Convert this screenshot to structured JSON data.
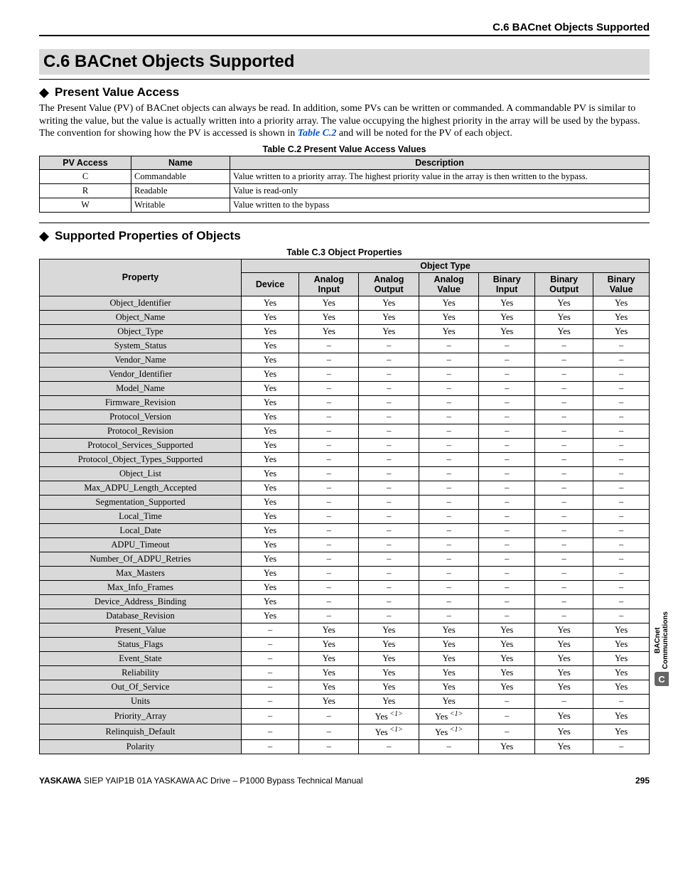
{
  "header": {
    "running": "C.6 BACnet Objects Supported"
  },
  "section": {
    "number_title": "C.6  BACnet Objects Supported"
  },
  "sub1": {
    "title": "Present Value Access",
    "para1a": "The Present Value (PV) of BACnet objects can always be read. In addition, some PVs can be written or commanded. A commandable PV is similar to writing the value, but the value is actually written into a priority array. The value occupying the highest priority in the array will be used by the bypass. The convention for showing how the PV is accessed is shown in ",
    "tableref": "Table C.2",
    "para1b": " and will be noted for the PV of each object."
  },
  "table_c2": {
    "caption": "Table C.2  Present Value Access Values",
    "headers": [
      "PV Access",
      "Name",
      "Description"
    ],
    "rows": [
      [
        "C",
        "Commandable",
        "Value written to a priority array. The highest priority value in the array is then written to the bypass."
      ],
      [
        "R",
        "Readable",
        "Value is read-only"
      ],
      [
        "W",
        "Writable",
        "Value written to the bypass"
      ]
    ]
  },
  "sub2": {
    "title": "Supported Properties of Objects"
  },
  "table_c3": {
    "caption": "Table C.3  Object Properties",
    "h_prop": "Property",
    "h_group": "Object Type",
    "cols": [
      "Device",
      "Analog Input",
      "Analog Output",
      "Analog Value",
      "Binary Input",
      "Binary Output",
      "Binary Value"
    ],
    "rows": [
      {
        "p": "Object_Identifier",
        "v": [
          "Yes",
          "Yes",
          "Yes",
          "Yes",
          "Yes",
          "Yes",
          "Yes"
        ]
      },
      {
        "p": "Object_Name",
        "v": [
          "Yes",
          "Yes",
          "Yes",
          "Yes",
          "Yes",
          "Yes",
          "Yes"
        ]
      },
      {
        "p": "Object_Type",
        "v": [
          "Yes",
          "Yes",
          "Yes",
          "Yes",
          "Yes",
          "Yes",
          "Yes"
        ]
      },
      {
        "p": "System_Status",
        "v": [
          "Yes",
          "–",
          "–",
          "–",
          "–",
          "–",
          "–"
        ]
      },
      {
        "p": "Vendor_Name",
        "v": [
          "Yes",
          "–",
          "–",
          "–",
          "–",
          "–",
          "–"
        ]
      },
      {
        "p": "Vendor_Identifier",
        "v": [
          "Yes",
          "–",
          "–",
          "–",
          "–",
          "–",
          "–"
        ]
      },
      {
        "p": "Model_Name",
        "v": [
          "Yes",
          "–",
          "–",
          "–",
          "–",
          "–",
          "–"
        ]
      },
      {
        "p": "Firmware_Revision",
        "v": [
          "Yes",
          "–",
          "–",
          "–",
          "–",
          "–",
          "–"
        ]
      },
      {
        "p": "Protocol_Version",
        "v": [
          "Yes",
          "–",
          "–",
          "–",
          "–",
          "–",
          "–"
        ]
      },
      {
        "p": "Protocol_Revision",
        "v": [
          "Yes",
          "–",
          "–",
          "–",
          "–",
          "–",
          "–"
        ]
      },
      {
        "p": "Protocol_Services_Supported",
        "v": [
          "Yes",
          "–",
          "–",
          "–",
          "–",
          "–",
          "–"
        ]
      },
      {
        "p": "Protocol_Object_Types_Supported",
        "v": [
          "Yes",
          "–",
          "–",
          "–",
          "–",
          "–",
          "–"
        ]
      },
      {
        "p": "Object_List",
        "v": [
          "Yes",
          "–",
          "–",
          "–",
          "–",
          "–",
          "–"
        ]
      },
      {
        "p": "Max_ADPU_Length_Accepted",
        "v": [
          "Yes",
          "–",
          "–",
          "–",
          "–",
          "–",
          "–"
        ]
      },
      {
        "p": "Segmentation_Supported",
        "v": [
          "Yes",
          "–",
          "–",
          "–",
          "–",
          "–",
          "–"
        ]
      },
      {
        "p": "Local_Time",
        "v": [
          "Yes",
          "–",
          "–",
          "–",
          "–",
          "–",
          "–"
        ]
      },
      {
        "p": "Local_Date",
        "v": [
          "Yes",
          "–",
          "–",
          "–",
          "–",
          "–",
          "–"
        ]
      },
      {
        "p": "ADPU_Timeout",
        "v": [
          "Yes",
          "–",
          "–",
          "–",
          "–",
          "–",
          "–"
        ]
      },
      {
        "p": "Number_Of_ADPU_Retries",
        "v": [
          "Yes",
          "–",
          "–",
          "–",
          "–",
          "–",
          "–"
        ]
      },
      {
        "p": "Max_Masters",
        "v": [
          "Yes",
          "–",
          "–",
          "–",
          "–",
          "–",
          "–"
        ]
      },
      {
        "p": "Max_Info_Frames",
        "v": [
          "Yes",
          "–",
          "–",
          "–",
          "–",
          "–",
          "–"
        ]
      },
      {
        "p": "Device_Address_Binding",
        "v": [
          "Yes",
          "–",
          "–",
          "–",
          "–",
          "–",
          "–"
        ]
      },
      {
        "p": "Database_Revision",
        "v": [
          "Yes",
          "–",
          "–",
          "–",
          "–",
          "–",
          "–"
        ]
      },
      {
        "p": "Present_Value",
        "v": [
          "–",
          "Yes",
          "Yes",
          "Yes",
          "Yes",
          "Yes",
          "Yes"
        ]
      },
      {
        "p": "Status_Flags",
        "v": [
          "–",
          "Yes",
          "Yes",
          "Yes",
          "Yes",
          "Yes",
          "Yes"
        ]
      },
      {
        "p": "Event_State",
        "v": [
          "–",
          "Yes",
          "Yes",
          "Yes",
          "Yes",
          "Yes",
          "Yes"
        ]
      },
      {
        "p": "Reliability",
        "v": [
          "–",
          "Yes",
          "Yes",
          "Yes",
          "Yes",
          "Yes",
          "Yes"
        ]
      },
      {
        "p": "Out_Of_Service",
        "v": [
          "–",
          "Yes",
          "Yes",
          "Yes",
          "Yes",
          "Yes",
          "Yes"
        ]
      },
      {
        "p": "Units",
        "v": [
          "–",
          "Yes",
          "Yes",
          "Yes",
          "–",
          "–",
          "–"
        ]
      },
      {
        "p": "Priority_Array",
        "v": [
          "–",
          "–",
          "Yes",
          "Yes",
          "–",
          "Yes",
          "Yes"
        ],
        "note": [
          false,
          false,
          true,
          true,
          false,
          false,
          false
        ]
      },
      {
        "p": "Relinquish_Default",
        "v": [
          "–",
          "–",
          "Yes",
          "Yes",
          "–",
          "Yes",
          "Yes"
        ],
        "note": [
          false,
          false,
          true,
          true,
          false,
          false,
          false
        ]
      },
      {
        "p": "Polarity",
        "v": [
          "–",
          "–",
          "–",
          "–",
          "Yes",
          "Yes",
          "–"
        ]
      }
    ],
    "note_marker": "<1>"
  },
  "footer": {
    "brand": "YASKAWA",
    "rest": " SIEP YAIP1B 01A YASKAWA AC Drive – P1000 Bypass Technical Manual",
    "page": "295"
  },
  "sidetab": {
    "line1": "BACnet",
    "line2": "Communications",
    "badge": "C"
  }
}
